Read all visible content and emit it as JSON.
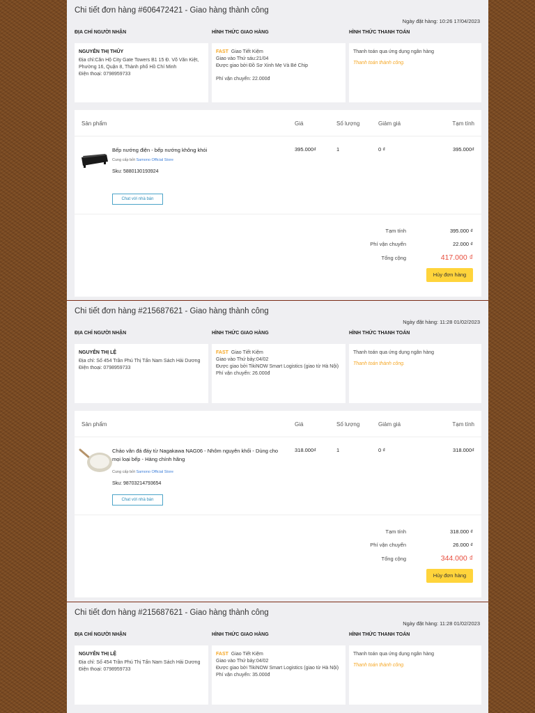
{
  "labels": {
    "recipient_head": "ĐỊA CHỈ NGƯỜI NHẬN",
    "shipping_head": "HÌNH THỨC GIAO HÀNG",
    "payment_head": "HÌNH THỨC THANH TOÁN",
    "col_product": "Sản phẩm",
    "col_price": "Giá",
    "col_qty": "Số lượng",
    "col_discount": "Giảm giá",
    "col_subtotal": "Tạm tính",
    "subtotal_label": "Tạm tính",
    "shipping_fee_label": "Phí vận chuyển",
    "total_label": "Tổng cộng",
    "chat_button": "Chat với nhà bán",
    "cancel_button": "Hủy đơn hàng",
    "fast": "FAST"
  },
  "orders": [
    {
      "title": "Chi tiết đơn hàng #606472421 - Giao hàng thành công",
      "order_date": "Ngày đặt hàng: 10:26 17/04/2023",
      "recipient": {
        "name": "NGUYỄN THỊ THỦY",
        "address": "Địa chỉ:Căn Hộ City Gate Towers B1 15 Đ. Võ Văn Kiệt, Phường 16, Quận 8, Thành phố Hồ Chí Minh",
        "phone": "Điện thoại: 0798959733"
      },
      "shipping": {
        "method": "Giao Tiết Kiệm",
        "delivery": "Giao vào Thứ sáu:21/04",
        "carrier": "Được giao bởi Đồ Sơ Xinh Mẹ Và Bé Chip",
        "fee": "Phí vận chuyển: 22.000đ"
      },
      "payment": {
        "method": "Thanh toán qua ứng dụng ngân hàng",
        "status": "Thanh toán thành công."
      },
      "product": {
        "name": "Bếp nướng điện - bếp nướng không khói",
        "seller_prefix": "Cung cấp bởi",
        "seller": "Samono Official Store",
        "sku": "Sku: 5880130193924",
        "price": "395.000₫",
        "qty": "1",
        "discount": "0 ₫",
        "subtotal": "395.000₫",
        "thumb": "grill-thumbnail"
      },
      "totals": {
        "subtotal": "395.000 ₫",
        "shipping": "22.000 ₫",
        "total": "417.000 ₫"
      }
    },
    {
      "title": "Chi tiết đơn hàng #215687621 - Giao hàng thành công",
      "order_date": "Ngày đặt hàng: 11:28 01/02/2023",
      "recipient": {
        "name": "NGUYỄN THỊ LỆ",
        "address": "Địa chỉ: Số 454 Trần Phú Thị Tấn Nam Sách Hải Dương",
        "phone": "Điện thoại: 0798959733"
      },
      "shipping": {
        "method": "Giao Tiết Kiệm",
        "delivery": "Giao vào Thứ bảy:04/02",
        "carrier": "Được giao bởi TikiNOW Smart Logistics (giao từ Hà Nội)",
        "fee": "Phí vận chuyển: 26.000đ"
      },
      "payment": {
        "method": "Thanh toán qua ứng dụng ngân hàng",
        "status": "Thanh toán thành công."
      },
      "product": {
        "name": "Chảo vân đá đáy từ Nagakawa NAG06 - Nhôm nguyên khối - Dùng cho mọi loại bếp - Hàng chính hãng",
        "seller_prefix": "Cung cấp bởi",
        "seller": "Samono Official Store",
        "sku": "Sku: 98703214793654",
        "price": "318.000₫",
        "qty": "1",
        "discount": "0 ₫",
        "subtotal": "318.000₫",
        "thumb": "pan-thumbnail"
      },
      "totals": {
        "subtotal": "318.000 ₫",
        "shipping": "26.000 ₫",
        "total": "344.000 ₫"
      }
    },
    {
      "title": "Chi tiết đơn hàng #215687621 - Giao hàng thành công",
      "order_date": "Ngày đặt hàng: 11:28 01/02/2023",
      "recipient": {
        "name": "NGUYỄN THỊ LỆ",
        "address": "Địa chỉ: Số 454 Trần Phú Thị Tấn Nam Sách Hải Dương",
        "phone": "Điện thoại: 0798959733"
      },
      "shipping": {
        "method": "Giao Tiết Kiệm",
        "delivery": "Giao vào Thứ bảy:04/02",
        "carrier": "Được giao bởi TikiNOW Smart Logistics (giao từ Hà Nội)",
        "fee": "Phí vận chuyển: 35.000đ"
      },
      "payment": {
        "method": "Thanh toán qua ứng dụng ngân hàng",
        "status": "Thanh toán thành công."
      }
    }
  ],
  "colors": {
    "background": "#7a4a22",
    "accent_yellow": "#ffd43b",
    "fast_orange": "#f5a623",
    "total_red": "#e74c3c",
    "link_blue": "#3b7dd8"
  }
}
